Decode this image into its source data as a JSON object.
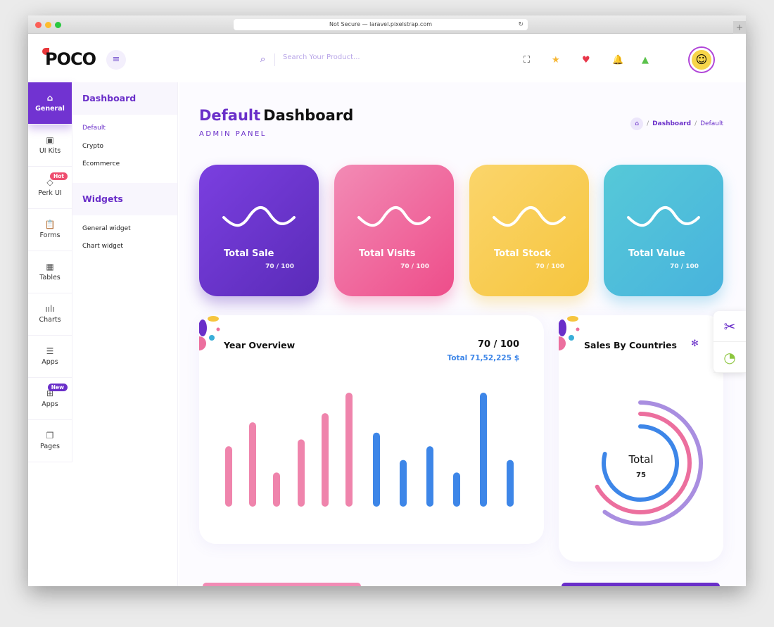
{
  "browser": {
    "url": "Not Secure — laravel.pixelstrap.com"
  },
  "header": {
    "logo": "POCO",
    "search_placeholder": "Search Your Product...",
    "icons": [
      "fullscreen-icon",
      "star-icon",
      "heart-icon",
      "bell-icon",
      "image-icon"
    ]
  },
  "sidebar": {
    "items": [
      {
        "label": "General",
        "icon": "home-icon",
        "active": true
      },
      {
        "label": "UI Kits",
        "icon": "briefcase-icon"
      },
      {
        "label": "Perk UI",
        "icon": "diamond-icon",
        "badge": "Hot"
      },
      {
        "label": "Forms",
        "icon": "clipboard-icon"
      },
      {
        "label": "Tables",
        "icon": "table-icon"
      },
      {
        "label": "Charts",
        "icon": "bar-chart-icon"
      },
      {
        "label": "Apps",
        "icon": "database-icon"
      },
      {
        "label": "Apps",
        "icon": "gift-icon",
        "badge": "New"
      },
      {
        "label": "Pages",
        "icon": "pages-icon"
      }
    ]
  },
  "submenu": {
    "sections": [
      {
        "title": "Dashboard",
        "items": [
          "Default",
          "Crypto",
          "Ecommerce"
        ]
      },
      {
        "title": "Widgets",
        "items": [
          "General widget",
          "Chart widget"
        ]
      }
    ]
  },
  "page": {
    "title_accent": "Default",
    "title": "Dashboard",
    "subtitle": "ADMIN PANEL",
    "breadcrumb": [
      "Dashboard",
      "Default"
    ]
  },
  "stats": [
    {
      "title": "Total Sale",
      "value": "70 / 100",
      "colors": [
        "#7b3fe0",
        "#5a2bb8"
      ]
    },
    {
      "title": "Total Visits",
      "value": "70 / 100",
      "colors": [
        "#f28bb5",
        "#ee4d8a"
      ]
    },
    {
      "title": "Total Stock",
      "value": "70 / 100",
      "colors": [
        "#fbd56b",
        "#f6c53e"
      ]
    },
    {
      "title": "Total Value",
      "value": "70 / 100",
      "colors": [
        "#56c9d8",
        "#48b3dd"
      ]
    }
  ],
  "year_overview": {
    "title": "Year Overview",
    "score": "70 / 100",
    "total": "Total 71,52,225 $"
  },
  "sales_by_countries": {
    "title": "Sales By Countries",
    "center_label": "Total",
    "center_value": "75"
  },
  "chart_data": [
    {
      "type": "bar",
      "title": "Year Overview",
      "series": [
        {
          "values": [
            53,
            74,
            30,
            59,
            82,
            100
          ],
          "color": "#ec6f9e"
        },
        {
          "values": [
            65,
            41,
            53,
            30,
            100,
            41
          ],
          "color": "#3d86e8"
        }
      ]
    },
    {
      "type": "radialBar",
      "title": "Sales By Countries",
      "values": [
        79,
        67,
        60
      ],
      "colors": [
        "#3d86e8",
        "#ec6f9e",
        "#a98ee0"
      ],
      "total": 75
    }
  ]
}
